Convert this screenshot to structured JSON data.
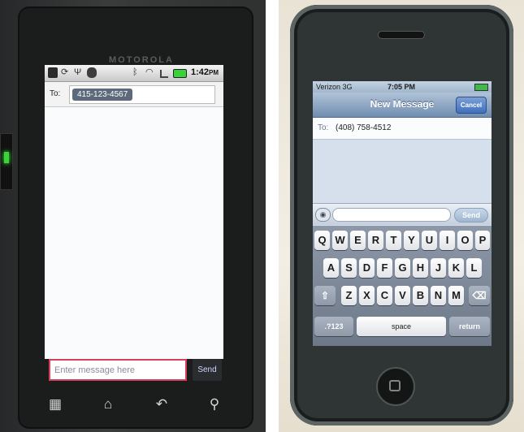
{
  "android": {
    "brand": "MOTOROLA",
    "status_time": "1:42",
    "status_ampm": "PM",
    "to_label": "To:",
    "recipient": "415-123-4567",
    "message_placeholder": "Enter message here",
    "send_label": "Send",
    "nav_icons": [
      "apps-grid-icon",
      "home-icon",
      "back-icon",
      "search-icon"
    ]
  },
  "iphone": {
    "carrier": "Verizon",
    "network": "3G",
    "status_time": "7:05 PM",
    "title": "New Message",
    "cancel_label": "Cancel",
    "to_label": "To:",
    "recipient": "(408) 758-4512",
    "send_label": "Send",
    "keyboard": {
      "row1": [
        "Q",
        "W",
        "E",
        "R",
        "T",
        "Y",
        "U",
        "I",
        "O",
        "P"
      ],
      "row2": [
        "A",
        "S",
        "D",
        "F",
        "G",
        "H",
        "J",
        "K",
        "L"
      ],
      "row3": [
        "Z",
        "X",
        "C",
        "V",
        "B",
        "N",
        "M"
      ],
      "numbers_key": ".?123",
      "space_key": "space",
      "return_key": "return"
    }
  }
}
